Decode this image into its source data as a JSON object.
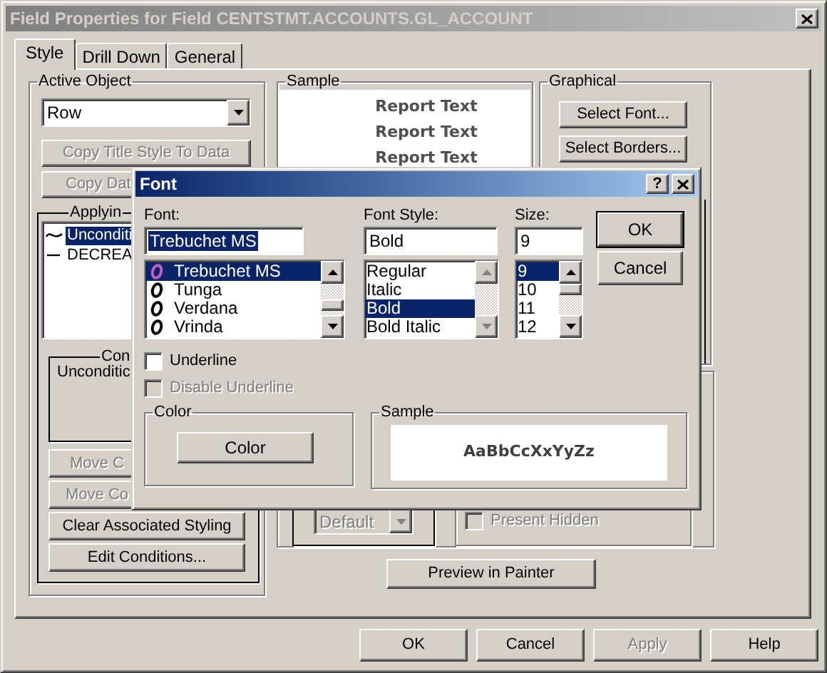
{
  "window": {
    "title": "Field Properties for Field CENTSTMT.ACCOUNTS.GL_ACCOUNT"
  },
  "tabs": [
    {
      "label": "Style",
      "selected": true
    },
    {
      "label": "Drill Down",
      "selected": false
    },
    {
      "label": "General",
      "selected": false
    }
  ],
  "active_object": {
    "label": "Active Object",
    "combo": "Row",
    "buttons": [
      {
        "label": "Copy Title Style To Data",
        "disabled": true
      },
      {
        "label": "Copy Dat",
        "disabled": true
      }
    ]
  },
  "applying": {
    "label": "Applyin",
    "items": [
      {
        "label": "Unconditi",
        "kind": "wave",
        "selected": true
      },
      {
        "label": "DECREA",
        "kind": "dash",
        "selected": false
      }
    ],
    "condition": {
      "label": "Con",
      "text": "Unconditic"
    },
    "buttons": [
      {
        "label": "Move C",
        "disabled": true
      },
      {
        "label": "Move Co",
        "disabled": true
      },
      {
        "label": "Clear Associated Styling",
        "disabled": false
      },
      {
        "label": "Edit Conditions...",
        "disabled": false
      }
    ]
  },
  "sample": {
    "label": "Sample",
    "lines": [
      "Report Text",
      "Report Text",
      "Report Text"
    ]
  },
  "graphical": {
    "label": "Graphical",
    "buttons": [
      "Select Font...",
      "Select Borders..."
    ]
  },
  "hidden_options": {
    "combo": "Default",
    "combo_disabled": true,
    "checkbox": {
      "label": "Present Hidden",
      "checked": false,
      "disabled": true
    }
  },
  "preview_button": "Preview in Painter",
  "footer_buttons": [
    {
      "label": "OK",
      "disabled": false
    },
    {
      "label": "Cancel",
      "disabled": false
    },
    {
      "label": "Apply",
      "disabled": true
    },
    {
      "label": "Help",
      "disabled": false
    }
  ],
  "font_dialog": {
    "title": "Font",
    "help": "?",
    "columns": [
      {
        "label": "Font:",
        "value": "Trebuchet MS",
        "highlighted": true,
        "items": [
          {
            "label": "Trebuchet MS",
            "selected": true
          },
          {
            "label": "Tunga",
            "selected": false
          },
          {
            "label": "Verdana",
            "selected": false
          },
          {
            "label": "Vrinda",
            "selected": false
          }
        ]
      },
      {
        "label": "Font Style:",
        "value": "Bold",
        "highlighted": false,
        "items": [
          {
            "label": "Regular",
            "selected": false
          },
          {
            "label": "Italic",
            "selected": false
          },
          {
            "label": "Bold",
            "selected": true
          },
          {
            "label": "Bold Italic",
            "selected": false
          }
        ]
      },
      {
        "label": "Size:",
        "value": "9",
        "highlighted": false,
        "items": [
          {
            "label": "9",
            "selected": true
          },
          {
            "label": "10",
            "selected": false
          },
          {
            "label": "11",
            "selected": false
          },
          {
            "label": "12",
            "selected": false
          }
        ]
      }
    ],
    "buttons": [
      {
        "label": "OK",
        "default": true
      },
      {
        "label": "Cancel",
        "default": false
      }
    ],
    "checkboxes": [
      {
        "label": "Underline",
        "checked": false,
        "disabled": false
      },
      {
        "label": "Disable Underline",
        "checked": false,
        "disabled": true
      }
    ],
    "color_group": {
      "label": "Color",
      "button": "Color"
    },
    "sample_group": {
      "label": "Sample",
      "text": "AaBbCcXxYyZz"
    }
  }
}
